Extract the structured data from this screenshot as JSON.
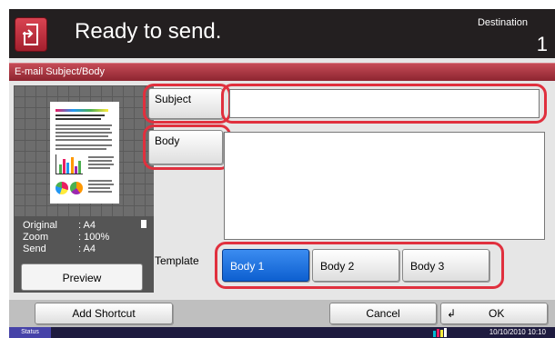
{
  "header": {
    "title": "Ready to send.",
    "destination_label": "Destination",
    "destination_count": "1"
  },
  "panel": {
    "title": "E-mail Subject/Body"
  },
  "preview": {
    "original_label": "Original",
    "original_value": ": A4",
    "zoom_label": "Zoom",
    "zoom_value": ": 100%",
    "send_label": "Send",
    "send_value": ": A4",
    "button_label": "Preview"
  },
  "subject": {
    "button_label": "Subject",
    "value": ""
  },
  "body": {
    "button_label": "Body",
    "value": ""
  },
  "template": {
    "label": "Template",
    "options": [
      "Body 1",
      "Body 2",
      "Body 3"
    ],
    "selected": "Body 1"
  },
  "footer": {
    "add_shortcut_label": "Add Shortcut",
    "cancel_label": "Cancel",
    "ok_label": "OK"
  },
  "status": {
    "button_label": "Status",
    "datetime": "10/10/2010  10:10"
  },
  "colors": {
    "accent": "#e0303e",
    "selected": "#1a73e8",
    "header_bg": "#231f20",
    "panel_header": "#a33340"
  }
}
